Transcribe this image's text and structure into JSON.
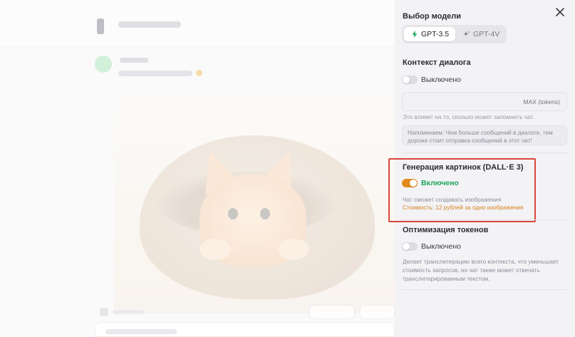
{
  "panel": {
    "model_section": {
      "title": "Выбор модели",
      "options": [
        {
          "label": "GPT-3.5",
          "icon": "bolt-icon",
          "selected": true
        },
        {
          "label": "GPT-4V",
          "icon": "sparkle-icon",
          "selected": false
        }
      ]
    },
    "context_section": {
      "title": "Контекст диалога",
      "toggle_label": "Выключено",
      "enabled": false,
      "max_placeholder": "MAX (tokens)",
      "hint": "Это влияет на то, сколько может запомнить чат.",
      "notice": "Напоминаем: Чем больше сообщений в диалоге, тем дороже стоит отправка сообщений в этот чат!"
    },
    "image_section": {
      "title": "Генерация картинок (DALL·E 3)",
      "toggle_label": "Включено",
      "enabled": true,
      "hint": "Чат сможет создавать изображения",
      "cost": "Стоимость: 12 рублей за одно изображения"
    },
    "optimization_section": {
      "title": "Оптимизация токенов",
      "toggle_label": "Выключено",
      "enabled": false,
      "description": "Делает транслитерацию всего контекста, что уменьшает стоимость запросов, но чат также может отвечать транслитерированным текстом."
    }
  },
  "colors": {
    "accent_orange": "#e28a1c",
    "enabled_green": "#1aa45a",
    "highlight_red": "#d9463a"
  }
}
